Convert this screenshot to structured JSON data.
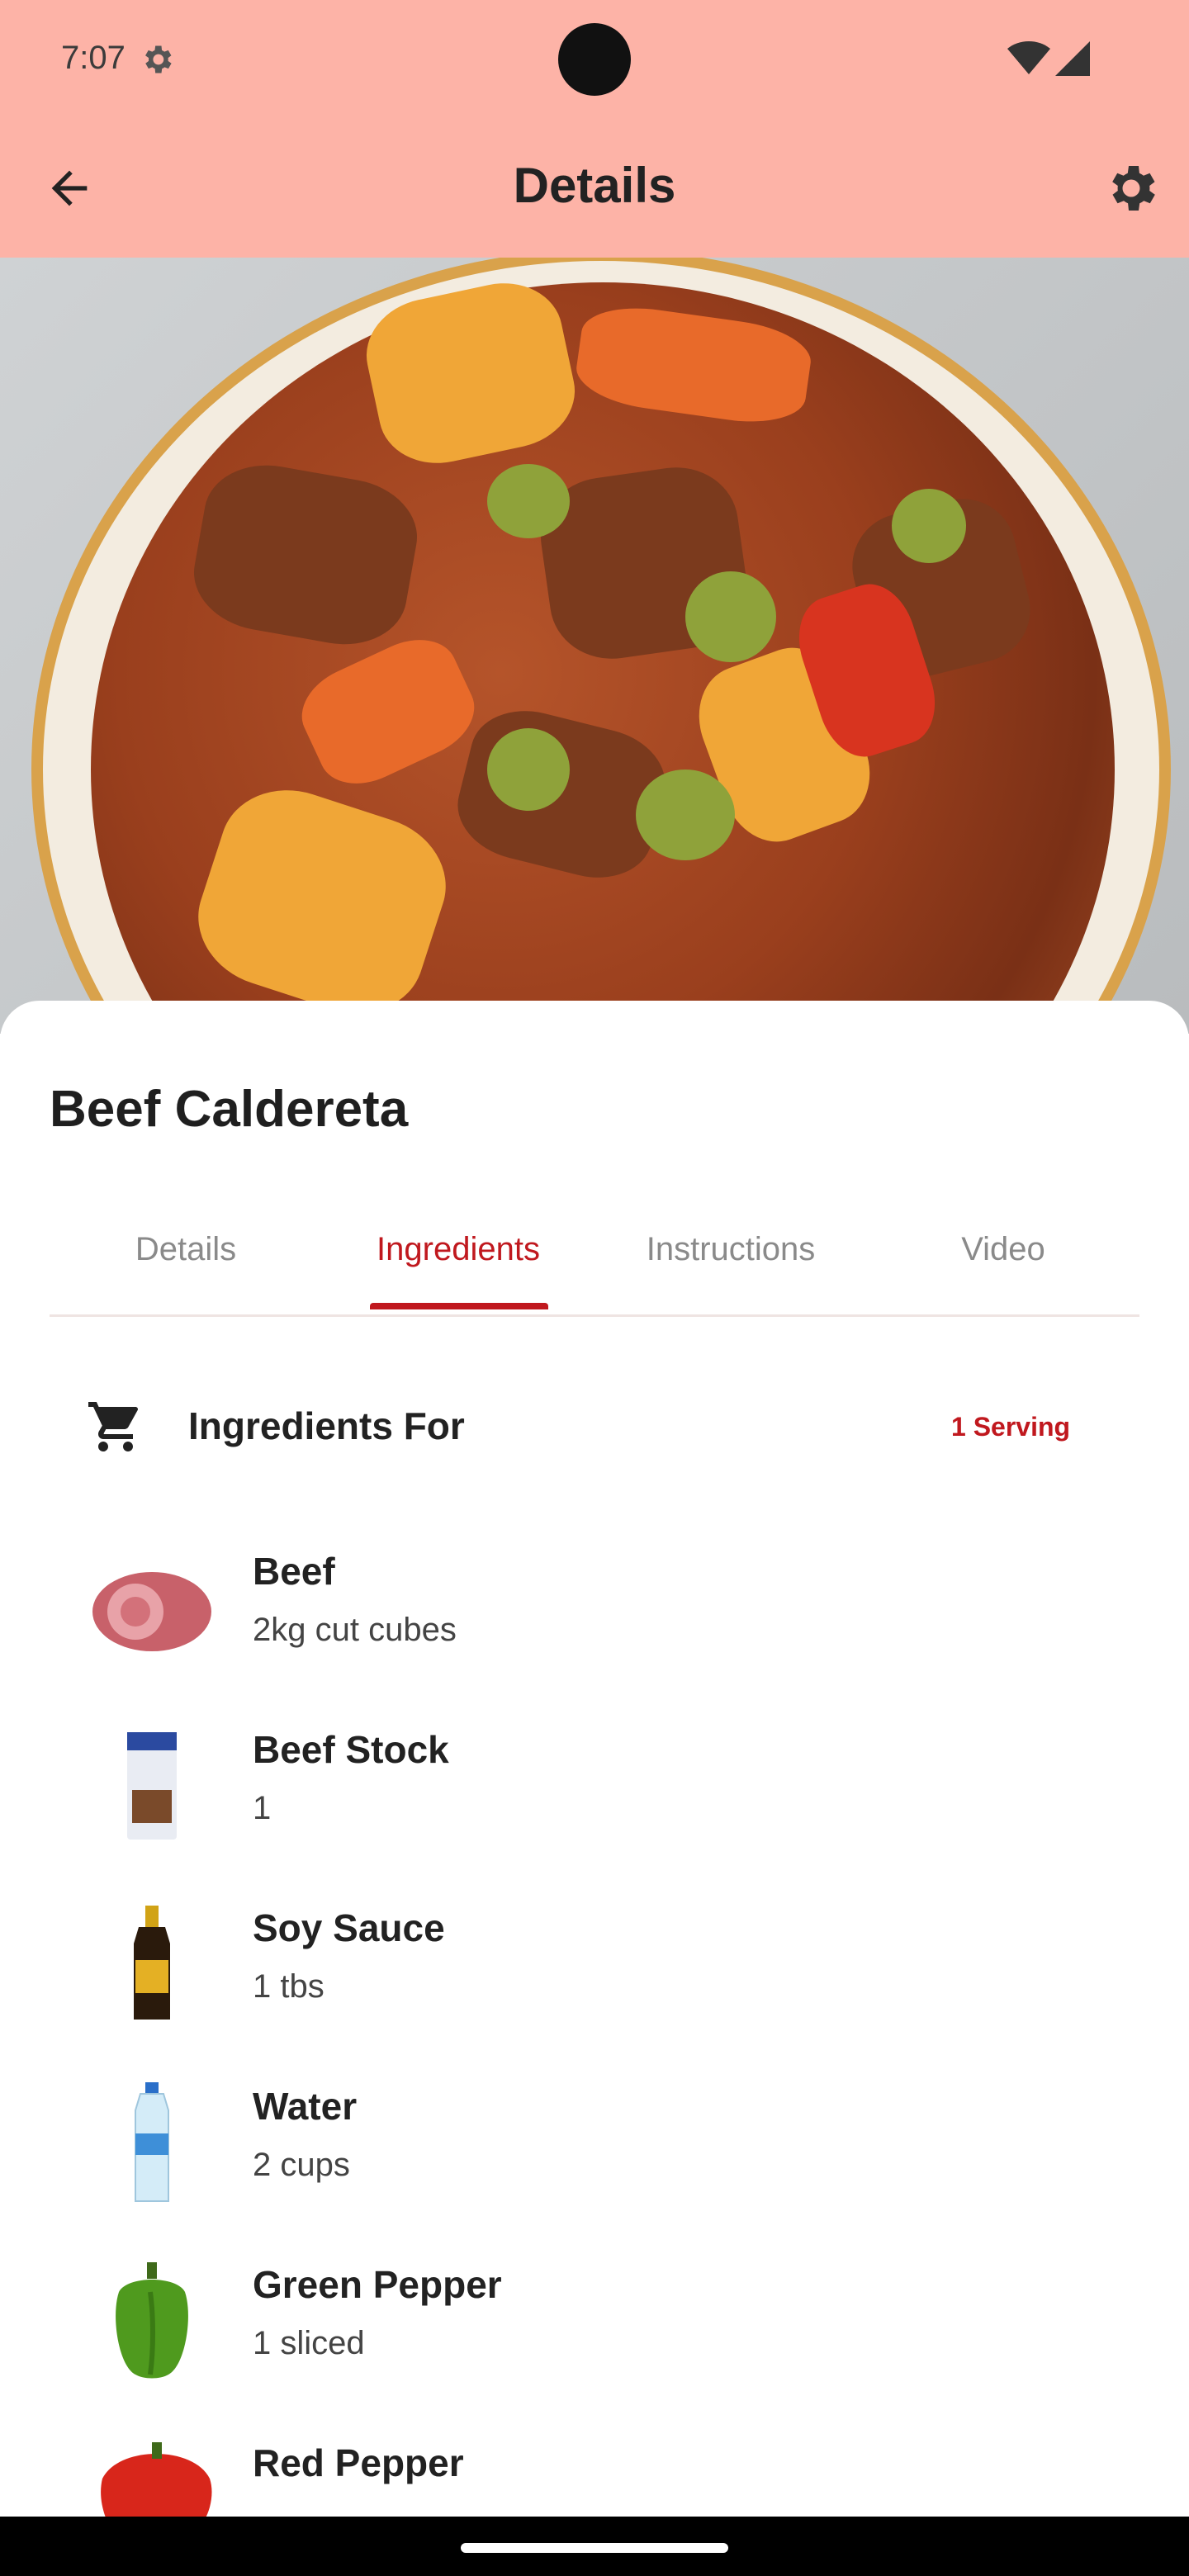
{
  "status": {
    "time": "7:07"
  },
  "appbar": {
    "title": "Details"
  },
  "recipe": {
    "name": "Beef Caldereta"
  },
  "tabs": [
    {
      "label": "Details"
    },
    {
      "label": "Ingredients"
    },
    {
      "label": "Instructions"
    },
    {
      "label": "Video"
    }
  ],
  "ingredients_header": {
    "label": "Ingredients For",
    "serving": "1 Serving"
  },
  "ingredients": [
    {
      "name": "Beef",
      "qty": "2kg cut cubes"
    },
    {
      "name": "Beef Stock",
      "qty": "1"
    },
    {
      "name": "Soy Sauce",
      "qty": "1 tbs"
    },
    {
      "name": "Water",
      "qty": "2 cups"
    },
    {
      "name": "Green Pepper",
      "qty": "1 sliced"
    },
    {
      "name": "Red Pepper",
      "qty": ""
    }
  ],
  "colors": {
    "appbar": "#fdb3a7",
    "accent": "#c0181e"
  }
}
